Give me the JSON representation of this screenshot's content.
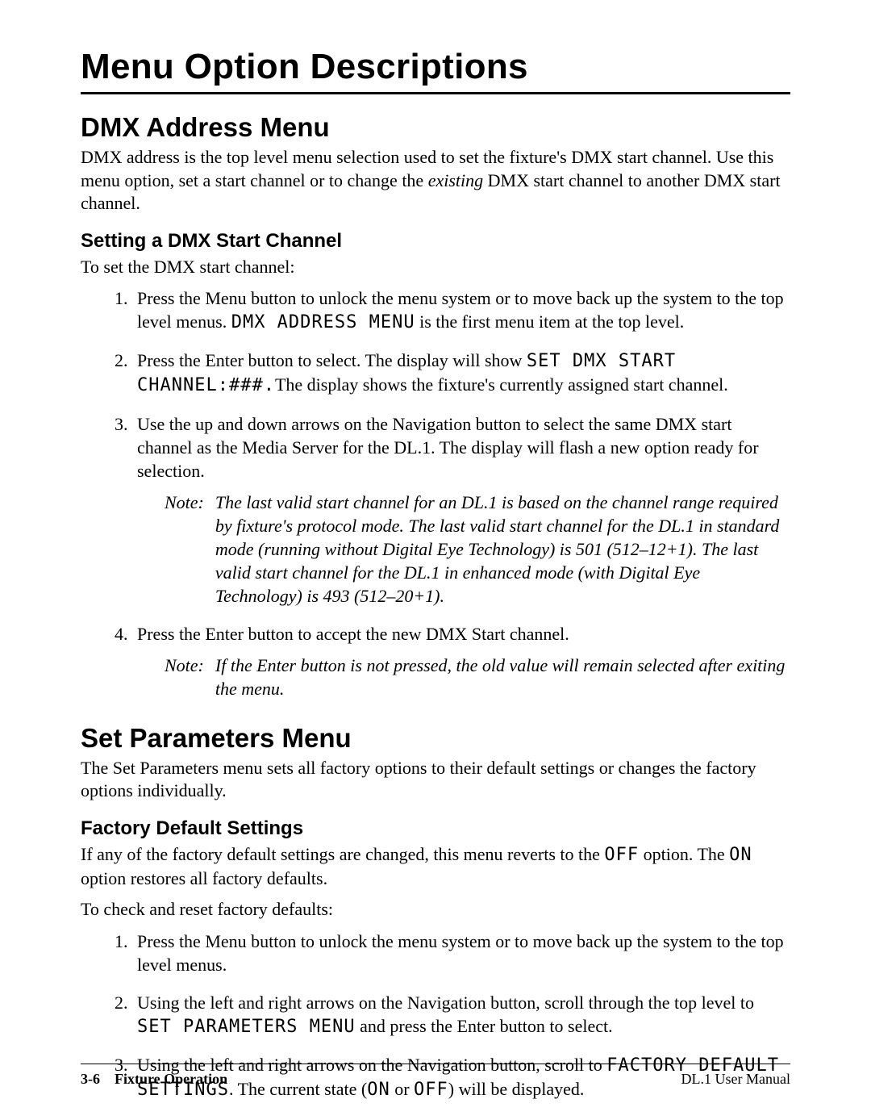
{
  "title": "Menu Option Descriptions",
  "dmx": {
    "heading": "DMX Address Menu",
    "intro_a": "DMX address is the top level menu selection used to set the fixture's DMX start channel. Use this menu option, set a start channel or to change the ",
    "intro_em": "existing",
    "intro_b": " DMX start channel to another DMX start channel.",
    "sub": "Setting a DMX Start Channel",
    "lead": "To set the DMX start channel:",
    "s1a": "Press the Menu button to unlock the menu system or to move back up the system to the top level menus. ",
    "s1code": "DMX ADDRESS MENU",
    "s1b": " is the first menu item at the top level.",
    "s2a": "Press the Enter button to select. The display will show ",
    "s2code": "SET DMX START CHANNEL:###.",
    "s2b": "The display shows the fixture's currently assigned start channel.",
    "s3": "Use the up and down arrows on the Navigation button to select the same DMX start channel as the Media Server for the DL.1. The display will flash a new option ready for selection.",
    "note1label": "Note:",
    "note1": "The last valid start channel for an DL.1 is based on the channel range required by fixture's protocol mode. The last valid start channel for the DL.1 in standard mode (running without  Digital Eye Technology) is 501 (512–12+1). The last valid start channel for the DL.1 in enhanced mode (with Digital Eye Technology) is 493 (512–20+1).",
    "s4": "Press the Enter button to accept the new DMX Start channel.",
    "note2label": "Note:",
    "note2": "If the Enter button is not pressed, the old value will remain selected after exiting the menu."
  },
  "params": {
    "heading": "Set Parameters Menu",
    "intro": "The Set Parameters menu sets all factory options to their default settings or changes the factory options individually.",
    "sub": "Factory Default Settings",
    "p1a": "If any of the factory default settings are changed, this menu reverts to the ",
    "p1c1": "OFF",
    "p1b": " option. The ",
    "p1c2": "ON",
    "p1c": " option restores all factory defaults.",
    "lead": "To check and reset factory defaults:",
    "s1": "Press the Menu button to unlock the menu system or to move back up the system to the top level menus.",
    "s2a": "Using the left and right arrows on the Navigation button, scroll through the top level to ",
    "s2code": "SET PARAMETERS MENU",
    "s2b": " and press the Enter button to select.",
    "s3a": "Using the left and right arrows on the Navigation button, scroll to ",
    "s3code1": "FACTORY DEFAULT SETTINGS",
    "s3b": ". The current state (",
    "s3code2": "ON",
    "s3c": " or ",
    "s3code3": "OFF",
    "s3d": ") will be displayed."
  },
  "footer": {
    "page": "3-6",
    "section": "Fixture Operation",
    "manual": "DL.1 User Manual"
  }
}
